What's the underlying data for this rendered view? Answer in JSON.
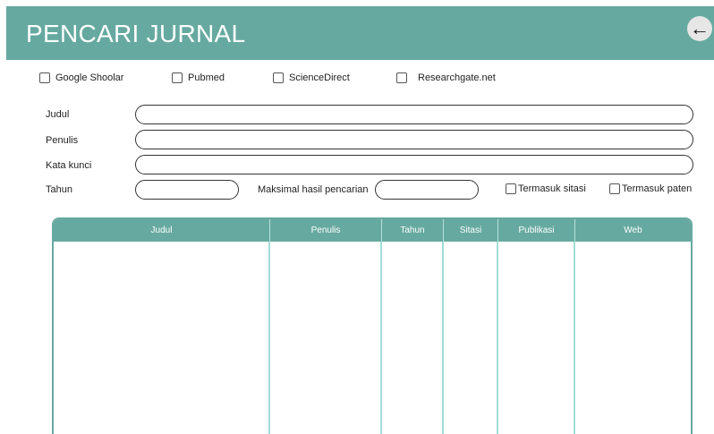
{
  "header": {
    "title": "PENCARI JURNAL",
    "back_icon": "arrow-left-icon"
  },
  "sources": [
    {
      "label": "Google Shoolar"
    },
    {
      "label": "Pubmed"
    },
    {
      "label": "ScienceDirect"
    },
    {
      "label": "Researchgate.net"
    }
  ],
  "form": {
    "judul_label": "Judul",
    "penulis_label": "Penulis",
    "kata_kunci_label": "Kata kunci",
    "tahun_label": "Tahun",
    "maks_label": "Maksimal hasil pencarian",
    "sitasi_label": "Termasuk sitasi",
    "paten_label": "Termasuk paten",
    "judul_value": "",
    "penulis_value": "",
    "kata_kunci_value": "",
    "tahun_value": "",
    "maks_value": ""
  },
  "table": {
    "columns": [
      "Judul",
      "Penulis",
      "Tahun",
      "Sitasi",
      "Publikasi",
      "Web"
    ]
  },
  "colors": {
    "accent": "#66a9a0",
    "divider": "#a3dcd6"
  }
}
